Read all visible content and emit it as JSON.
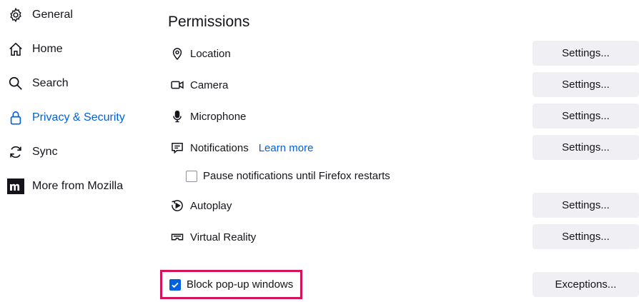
{
  "sidebar": {
    "items": [
      {
        "label": "General",
        "icon": "gear-icon"
      },
      {
        "label": "Home",
        "icon": "home-icon"
      },
      {
        "label": "Search",
        "icon": "search-icon"
      },
      {
        "label": "Privacy & Security",
        "icon": "lock-icon",
        "selected": true
      },
      {
        "label": "Sync",
        "icon": "sync-icon"
      },
      {
        "label": "More from Mozilla",
        "icon": "mozilla-icon"
      }
    ]
  },
  "permissions": {
    "title": "Permissions",
    "rows": [
      {
        "label": "Location",
        "icon": "location-pin-icon",
        "button": "Settings..."
      },
      {
        "label": "Camera",
        "icon": "camera-icon",
        "button": "Settings..."
      },
      {
        "label": "Microphone",
        "icon": "microphone-icon",
        "button": "Settings..."
      },
      {
        "label": "Notifications",
        "icon": "notification-icon",
        "button": "Settings...",
        "link": "Learn more"
      },
      {
        "label": "Autoplay",
        "icon": "autoplay-icon",
        "button": "Settings..."
      },
      {
        "label": "Virtual Reality",
        "icon": "vr-headset-icon",
        "button": "Settings..."
      }
    ],
    "pause_notifications": {
      "label": "Pause notifications until Firefox restarts",
      "checked": false
    },
    "block_popups": {
      "label": "Block pop-up windows",
      "checked": true,
      "button": "Exceptions..."
    }
  },
  "colors": {
    "accent": "#0061e0",
    "highlight": "#d4145a",
    "button_bg": "#f0f0f4"
  }
}
